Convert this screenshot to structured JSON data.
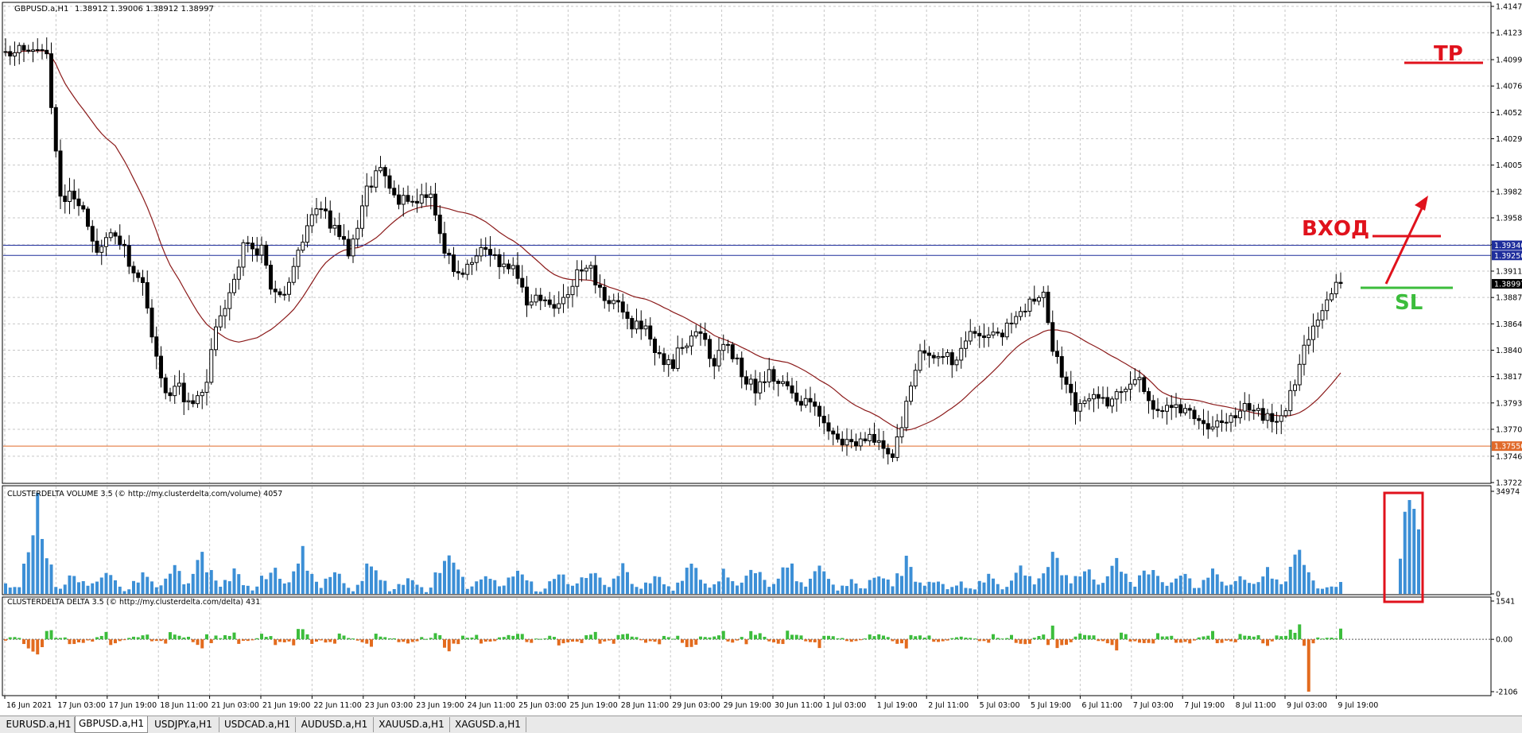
{
  "header": {
    "symbol": "GBPUSD.a,H1",
    "ohlc": "1.38912 1.39006 1.38912 1.38997"
  },
  "chart_data": [
    {
      "type": "candlestick",
      "title": "GBPUSD.a,H1",
      "ylim": [
        1.37225,
        1.4147
      ],
      "yticks": [
        "1.41470",
        "1.41235",
        "1.40995",
        "1.40760",
        "1.40525",
        "1.40290",
        "1.40055",
        "1.39820",
        "1.39585",
        "1.39345",
        "1.39110",
        "1.38875",
        "1.38640",
        "1.38405",
        "1.38170",
        "1.37935",
        "1.37700",
        "1.37460",
        "1.37225"
      ],
      "xticks": [
        "16 Jun 2021",
        "17 Jun 03:00",
        "17 Jun 19:00",
        "18 Jun 11:00",
        "21 Jun 03:00",
        "21 Jun 19:00",
        "22 Jun 11:00",
        "23 Jun 03:00",
        "23 Jun 19:00",
        "24 Jun 11:00",
        "25 Jun 03:00",
        "25 Jun 19:00",
        "28 Jun 11:00",
        "29 Jun 03:00",
        "29 Jun 19:00",
        "30 Jun 11:00",
        "1 Jul 03:00",
        "1 Jul 19:00",
        "2 Jul 11:00",
        "5 Jul 03:00",
        "5 Jul 19:00",
        "6 Jul 11:00",
        "7 Jul 03:00",
        "7 Jul 19:00",
        "8 Jul 11:00",
        "9 Jul 03:00",
        "9 Jul 19:00"
      ],
      "anchor_closes": [
        [
          0,
          1.4105
        ],
        [
          6,
          1.411
        ],
        [
          9,
          1.41
        ],
        [
          12,
          1.398
        ],
        [
          16,
          1.3975
        ],
        [
          20,
          1.3925
        ],
        [
          24,
          1.3945
        ],
        [
          27,
          1.392
        ],
        [
          30,
          1.3895
        ],
        [
          32,
          1.385
        ],
        [
          35,
          1.38
        ],
        [
          38,
          1.381
        ],
        [
          40,
          1.379
        ],
        [
          44,
          1.3815
        ],
        [
          46,
          1.386
        ],
        [
          49,
          1.389
        ],
        [
          52,
          1.3935
        ],
        [
          56,
          1.393
        ],
        [
          58,
          1.39
        ],
        [
          60,
          1.3885
        ],
        [
          63,
          1.391
        ],
        [
          67,
          1.3965
        ],
        [
          70,
          1.396
        ],
        [
          73,
          1.3945
        ],
        [
          75,
          1.393
        ],
        [
          77,
          1.3945
        ],
        [
          79,
          1.3985
        ],
        [
          82,
          1.4
        ],
        [
          86,
          1.3975
        ],
        [
          89,
          1.397
        ],
        [
          93,
          1.398
        ],
        [
          96,
          1.3925
        ],
        [
          99,
          1.391
        ],
        [
          102,
          1.392
        ],
        [
          105,
          1.393
        ],
        [
          108,
          1.392
        ],
        [
          111,
          1.3915
        ],
        [
          114,
          1.388
        ],
        [
          117,
          1.389
        ],
        [
          120,
          1.3875
        ],
        [
          123,
          1.3885
        ],
        [
          125,
          1.3915
        ],
        [
          128,
          1.391
        ],
        [
          131,
          1.389
        ],
        [
          134,
          1.388
        ],
        [
          137,
          1.3865
        ],
        [
          140,
          1.386
        ],
        [
          143,
          1.3835
        ],
        [
          146,
          1.383
        ],
        [
          149,
          1.385
        ],
        [
          152,
          1.3855
        ],
        [
          155,
          1.383
        ],
        [
          158,
          1.3845
        ],
        [
          161,
          1.382
        ],
        [
          164,
          1.3805
        ],
        [
          167,
          1.382
        ],
        [
          170,
          1.3815
        ],
        [
          173,
          1.379
        ],
        [
          176,
          1.38
        ],
        [
          179,
          1.3775
        ],
        [
          182,
          1.376
        ],
        [
          185,
          1.376
        ],
        [
          188,
          1.3762
        ],
        [
          191,
          1.3755
        ],
        [
          194,
          1.374
        ],
        [
          197,
          1.3795
        ],
        [
          200,
          1.384
        ],
        [
          204,
          1.3835
        ],
        [
          208,
          1.383
        ],
        [
          212,
          1.386
        ],
        [
          216,
          1.3855
        ],
        [
          220,
          1.386
        ],
        [
          224,
          1.3885
        ],
        [
          227,
          1.3895
        ],
        [
          229,
          1.384
        ],
        [
          231,
          1.382
        ],
        [
          234,
          1.379
        ],
        [
          237,
          1.38
        ],
        [
          241,
          1.3795
        ],
        [
          245,
          1.3805
        ],
        [
          248,
          1.3815
        ],
        [
          250,
          1.379
        ],
        [
          253,
          1.3785
        ],
        [
          257,
          1.379
        ],
        [
          260,
          1.378
        ],
        [
          263,
          1.377
        ],
        [
          266,
          1.3775
        ],
        [
          269,
          1.3785
        ],
        [
          272,
          1.379
        ],
        [
          275,
          1.378
        ],
        [
          278,
          1.3775
        ],
        [
          281,
          1.38
        ],
        [
          284,
          1.384
        ],
        [
          287,
          1.387
        ],
        [
          290,
          1.389
        ],
        [
          292,
          1.39
        ]
      ],
      "series": [
        {
          "name": "MA",
          "color": "#8b1a1a"
        }
      ],
      "levels": [
        {
          "label": "1.39340",
          "price": 1.3934,
          "color": "#1f2e9c"
        },
        {
          "label": "1.39250",
          "price": 1.3925,
          "color": "#1f2e9c"
        },
        {
          "label": "1.38997",
          "price": 1.38997,
          "color": "#000000"
        },
        {
          "label": "1.37550",
          "price": 1.3755,
          "color": "#e06a2a"
        }
      ]
    },
    {
      "type": "bar",
      "title": "CLUSTERDELTA VOLUME 3.5 (© http://my.clusterdelta.com/volume) 4057",
      "ylim": [
        0,
        34974
      ],
      "yticks": [
        "34974",
        "0"
      ],
      "color": "#3c8fd6",
      "peaks": [
        [
          0,
          5000
        ],
        [
          7,
          34900
        ],
        [
          15,
          9000
        ],
        [
          22,
          11000
        ],
        [
          30,
          8000
        ],
        [
          37,
          10500
        ],
        [
          43,
          17000
        ],
        [
          50,
          9000
        ],
        [
          58,
          11500
        ],
        [
          65,
          18000
        ],
        [
          72,
          9500
        ],
        [
          80,
          14000
        ],
        [
          88,
          7000
        ],
        [
          97,
          22000
        ],
        [
          105,
          9000
        ],
        [
          112,
          13000
        ],
        [
          121,
          8500
        ],
        [
          128,
          11500
        ],
        [
          135,
          11000
        ],
        [
          142,
          8000
        ],
        [
          150,
          13000
        ],
        [
          157,
          9000
        ],
        [
          164,
          11500
        ],
        [
          171,
          14000
        ],
        [
          178,
          10500
        ],
        [
          185,
          5500
        ],
        [
          191,
          9000
        ],
        [
          197,
          13500
        ],
        [
          203,
          7000
        ],
        [
          209,
          4500
        ],
        [
          215,
          8000
        ],
        [
          222,
          11000
        ],
        [
          229,
          20000
        ],
        [
          236,
          11000
        ],
        [
          243,
          17000
        ],
        [
          250,
          12000
        ],
        [
          257,
          10500
        ],
        [
          264,
          11000
        ],
        [
          270,
          8000
        ],
        [
          276,
          10500
        ],
        [
          283,
          21000
        ],
        [
          290,
          4500
        ]
      ],
      "last_bar": 4057,
      "highlight_bars": [
        12000,
        28000,
        32000,
        29000,
        22000
      ]
    },
    {
      "type": "bar",
      "title": "CLUSTERDELTA DELTA 3.5 (© http://my.clusterdelta.com/delta) 431",
      "ylim": [
        -2106,
        1541
      ],
      "yticks": [
        "1541",
        "0.00",
        "-2106"
      ],
      "positive_color": "#3cbd3c",
      "negative_color": "#e36b1e",
      "last_bar": 431,
      "min_bar": -2106
    }
  ],
  "annotations": {
    "tp": "TP",
    "entry": "ВХОД",
    "sl": "SL",
    "tp_color": "#e0121c",
    "entry_color": "#e0121c",
    "sl_color": "#3cbd3c",
    "box_color": "#e0121c"
  },
  "tabs": [
    {
      "label": "EURUSD.a,H1",
      "active": false
    },
    {
      "label": "GBPUSD.a,H1",
      "active": true
    },
    {
      "label": "USDJPY.a,H1",
      "active": false
    },
    {
      "label": "USDCAD.a,H1",
      "active": false
    },
    {
      "label": "AUDUSD.a,H1",
      "active": false
    },
    {
      "label": "XAUUSD.a,H1",
      "active": false
    },
    {
      "label": "XAGUSD.a,H1",
      "active": false
    }
  ]
}
